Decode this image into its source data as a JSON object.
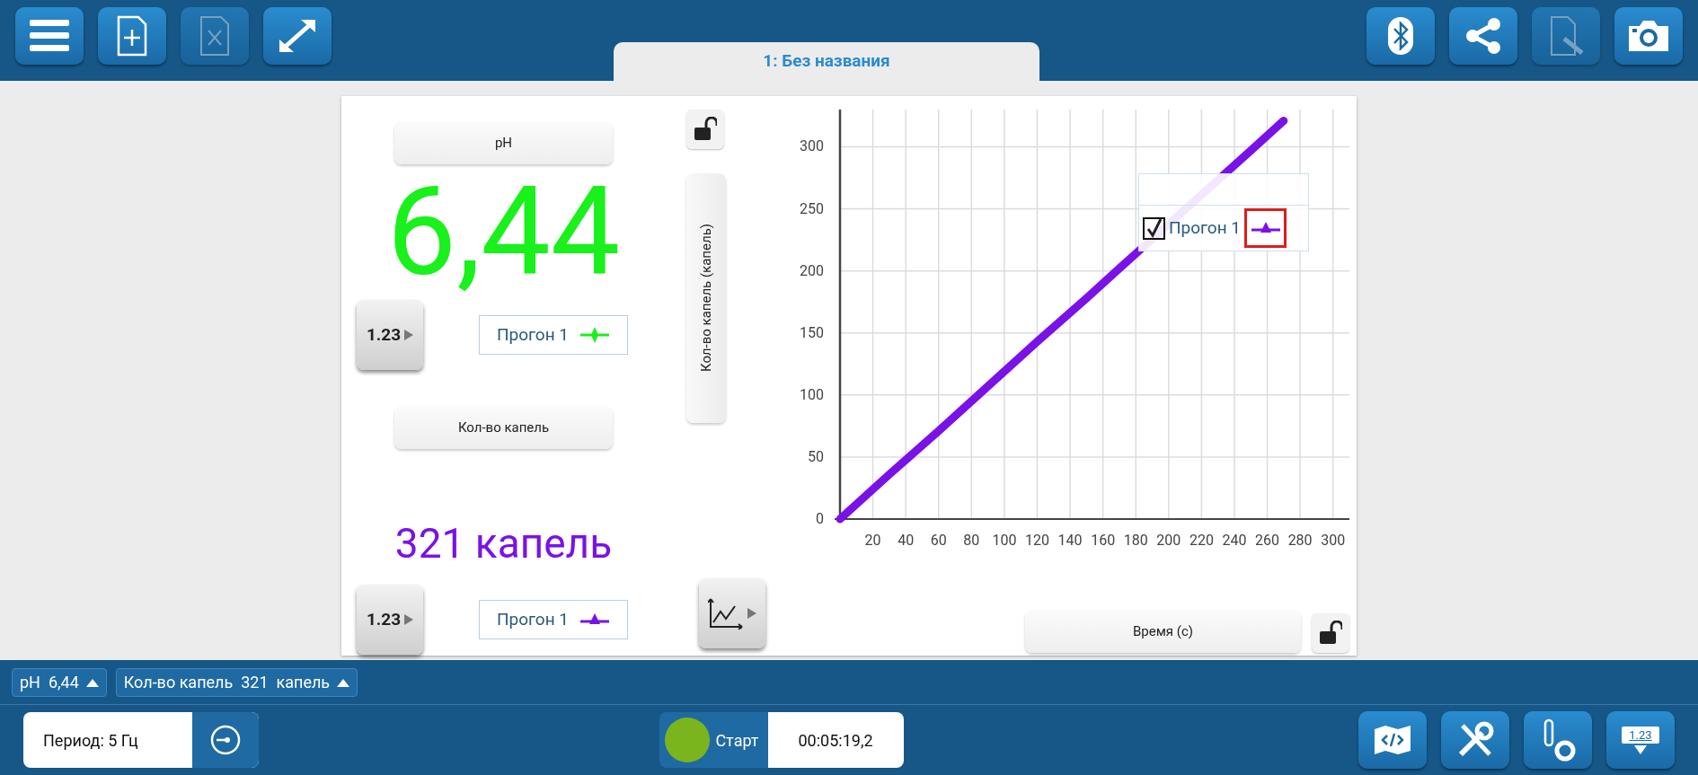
{
  "document_tab": {
    "title": "1: Без названия",
    "selected": true
  },
  "meters": [
    {
      "label": "pH",
      "value": "6,44",
      "color": "#19f01c",
      "legend": "Прогон 1",
      "display_button": "1.23",
      "kind": "diamond"
    },
    {
      "label": "Кол-во капель",
      "value": "321 капель",
      "color": "#7a12e6",
      "legend": "Прогон 1",
      "display_button": "1.23",
      "kind": "triangle"
    }
  ],
  "y_axis_button": "Кол-во капель (капель)",
  "x_axis_button": "Время (с)",
  "chart": {
    "legend": {
      "checked": true,
      "highlighted": true
    },
    "chart_data": {
      "type": "line",
      "grid": true,
      "x": [
        0,
        30,
        60,
        90,
        120,
        150,
        170,
        250,
        270
      ],
      "series": [
        {
          "name": "Прогон 1",
          "color": "#7a12e6",
          "values": [
            0,
            36,
            71,
            107,
            143,
            178,
            202,
            297,
            321
          ]
        }
      ],
      "xlim": [
        0,
        310
      ],
      "ylim": [
        0,
        330
      ],
      "xticks": [
        20,
        40,
        60,
        80,
        100,
        120,
        140,
        160,
        180,
        200,
        220,
        240,
        260,
        280,
        300
      ],
      "yticks": [
        0,
        50,
        100,
        150,
        200,
        250,
        300
      ]
    }
  },
  "meter_chips": [
    {
      "text": "pH  6,44"
    },
    {
      "text": "Кол-во капель  321  капель"
    }
  ],
  "period": "Период: 5 Гц",
  "start_button": "Старт",
  "timer": "00:05:19,2",
  "meter_menu_button": "1.23"
}
